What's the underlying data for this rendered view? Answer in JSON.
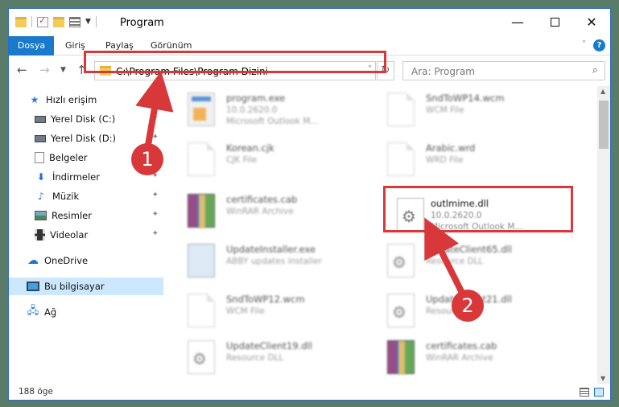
{
  "window": {
    "title": "Program"
  },
  "ribbon": {
    "tabs": [
      "Dosya",
      "Giriş",
      "Paylaş",
      "Görünüm"
    ],
    "help_label": "?"
  },
  "nav": {
    "address": "C:\\Program Files\\Program Dizini",
    "search_placeholder": "Ara: Program"
  },
  "sidebar": {
    "items": [
      {
        "label": "Hızlı erişim",
        "icon": "star-icon"
      },
      {
        "label": "Yerel Disk (C:)",
        "icon": "disk-icon"
      },
      {
        "label": "Yerel Disk (D:)",
        "icon": "disk-icon"
      },
      {
        "label": "Belgeler",
        "icon": "documents-icon"
      },
      {
        "label": "İndirmeler",
        "icon": "download-icon"
      },
      {
        "label": "Müzik",
        "icon": "music-icon"
      },
      {
        "label": "Resimler",
        "icon": "pictures-icon"
      },
      {
        "label": "Videolar",
        "icon": "videos-icon"
      },
      {
        "label": "OneDrive",
        "icon": "cloud-icon"
      },
      {
        "label": "Bu bilgisayar",
        "icon": "computer-icon"
      },
      {
        "label": "Ağ",
        "icon": "network-icon"
      }
    ]
  },
  "files": [
    {
      "name": "program.exe",
      "meta1": "10.0.2620.0",
      "meta2": "Microsoft Outlook M..."
    },
    {
      "name": "SndToWP14.wcm",
      "meta1": "WCM File",
      "meta2": ""
    },
    {
      "name": "Korean.cjk",
      "meta1": "CJK File",
      "meta2": ""
    },
    {
      "name": "Arabic.wrd",
      "meta1": "WRD File",
      "meta2": ""
    },
    {
      "name": "certificates.cab",
      "meta1": "WinRAR Archive",
      "meta2": ""
    },
    {
      "name": "outlmime.dll",
      "meta1": "10.0.2620.0",
      "meta2": "Microsoft Outlook M..."
    },
    {
      "name": "UpdateInstaller.exe",
      "meta1": "ABBY updates installer",
      "meta2": ""
    },
    {
      "name": "UpdateClient65.dll",
      "meta1": "Resource DLL",
      "meta2": ""
    },
    {
      "name": "SndToWP12.wcm",
      "meta1": "WCM File",
      "meta2": ""
    },
    {
      "name": "UpdateClient21.dll",
      "meta1": "Resource DLL",
      "meta2": ""
    },
    {
      "name": "UpdateClient19.dll",
      "meta1": "Resource DLL",
      "meta2": ""
    },
    {
      "name": "certificates.cab",
      "meta1": "WinRAR Archive",
      "meta2": ""
    }
  ],
  "annotations": {
    "step1": "1",
    "step2": "2",
    "color": "#d9383a"
  },
  "status": {
    "count": "188 öge"
  },
  "colors": {
    "accent": "#1979ca",
    "selection": "#cce8ff"
  }
}
